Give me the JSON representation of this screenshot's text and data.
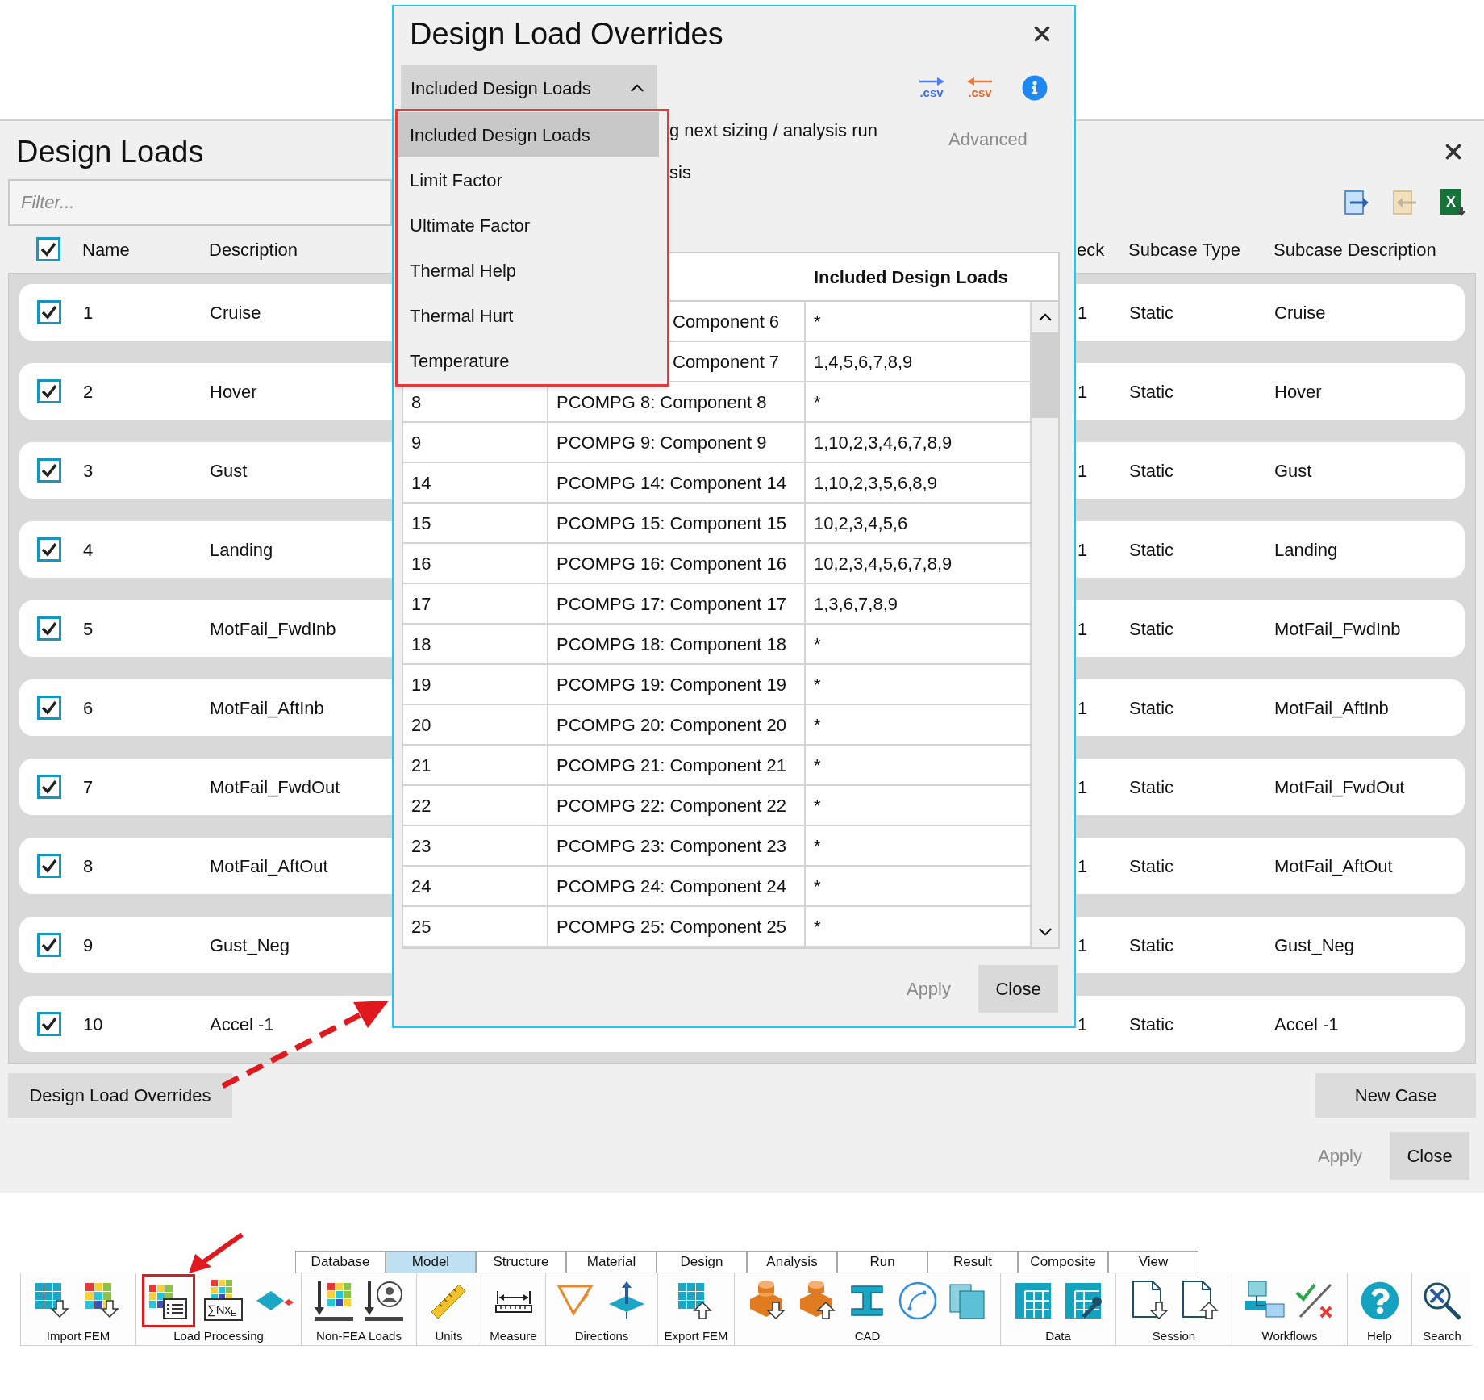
{
  "main_window": {
    "title": "Design Loads",
    "filter": {
      "placeholder": "Filter..."
    },
    "excel_icon_letter": "X",
    "select_all": {
      "checked": true
    },
    "columns": [
      "Name",
      "Description",
      "eck",
      "Subcase Type",
      "Subcase Description"
    ],
    "rows": [
      {
        "checked": true,
        "name": "1",
        "description": "Cruise",
        "column_3": "1",
        "subcase_type": "Static",
        "subcase_description": "Cruise"
      },
      {
        "checked": true,
        "name": "2",
        "description": "Hover",
        "column_3": "1",
        "subcase_type": "Static",
        "subcase_description": "Hover"
      },
      {
        "checked": true,
        "name": "3",
        "description": "Gust",
        "column_3": "1",
        "subcase_type": "Static",
        "subcase_description": "Gust"
      },
      {
        "checked": true,
        "name": "4",
        "description": "Landing",
        "column_3": "1",
        "subcase_type": "Static",
        "subcase_description": "Landing"
      },
      {
        "checked": true,
        "name": "5",
        "description": "MotFail_FwdInb",
        "column_3": "1",
        "subcase_type": "Static",
        "subcase_description": "MotFail_FwdInb"
      },
      {
        "checked": true,
        "name": "6",
        "description": "MotFail_AftInb",
        "column_3": "1",
        "subcase_type": "Static",
        "subcase_description": "MotFail_AftInb"
      },
      {
        "checked": true,
        "name": "7",
        "description": "MotFail_FwdOut",
        "column_3": "1",
        "subcase_type": "Static",
        "subcase_description": "MotFail_FwdOut"
      },
      {
        "checked": true,
        "name": "8",
        "description": "MotFail_AftOut",
        "column_3": "1",
        "subcase_type": "Static",
        "subcase_description": "MotFail_AftOut"
      },
      {
        "checked": true,
        "name": "9",
        "description": "Gust_Neg",
        "column_3": "1",
        "subcase_type": "Static",
        "subcase_description": "Gust_Neg"
      },
      {
        "checked": true,
        "name": "10",
        "description": "Accel -1",
        "column_3": "1",
        "subcase_type": "Static",
        "subcase_description": "Accel -1"
      }
    ],
    "overrides_button": "Design Load Overrides",
    "new_case_button": "New Case",
    "footer_buttons": [
      {
        "label": "Apply",
        "disabled": true
      },
      {
        "label": "Close",
        "disabled": false
      }
    ]
  },
  "dialog": {
    "title": "Design Load Overrides",
    "dropdown": {
      "value": "Included Design Loads",
      "expanded": true,
      "options": [
        {
          "label": "Included Design Loads",
          "selected": true
        },
        {
          "label": "Limit Factor",
          "selected": false
        },
        {
          "label": "Ultimate Factor",
          "selected": false
        },
        {
          "label": "Thermal Help",
          "selected": false
        },
        {
          "label": "Thermal Hurt",
          "selected": false
        },
        {
          "label": "Temperature",
          "selected": false
        }
      ]
    },
    "export_csv_label": ".csv",
    "import_csv_label": ".csv",
    "partial_texts": [
      "g next sizing / analysis run",
      "sis"
    ],
    "advanced": {
      "label": "Advanced",
      "disabled": true
    },
    "table": {
      "column_3_header": "Included Design Loads",
      "rows": [
        {
          "cell_2": "Component 6",
          "cell_3": "*"
        },
        {
          "cell_2": "Component 7",
          "cell_3": "1,4,5,6,7,8,9"
        },
        {
          "cell_1": "8",
          "cell_2": "PCOMPG 8: Component 8",
          "cell_3": "*"
        },
        {
          "cell_1": "9",
          "cell_2": "PCOMPG 9: Component 9",
          "cell_3": "1,10,2,3,4,6,7,8,9"
        },
        {
          "cell_1": "14",
          "cell_2": "PCOMPG 14: Component 14",
          "cell_3": "1,10,2,3,5,6,8,9"
        },
        {
          "cell_1": "15",
          "cell_2": "PCOMPG 15: Component 15",
          "cell_3": "10,2,3,4,5,6"
        },
        {
          "cell_1": "16",
          "cell_2": "PCOMPG 16: Component 16",
          "cell_3": "10,2,3,4,5,6,7,8,9"
        },
        {
          "cell_1": "17",
          "cell_2": "PCOMPG 17: Component 17",
          "cell_3": "1,3,6,7,8,9"
        },
        {
          "cell_1": "18",
          "cell_2": "PCOMPG 18: Component 18",
          "cell_3": "*"
        },
        {
          "cell_1": "19",
          "cell_2": "PCOMPG 19: Component 19",
          "cell_3": "*"
        },
        {
          "cell_1": "20",
          "cell_2": "PCOMPG 20: Component 20",
          "cell_3": "*"
        },
        {
          "cell_1": "21",
          "cell_2": "PCOMPG 21: Component 21",
          "cell_3": "*"
        },
        {
          "cell_1": "22",
          "cell_2": "PCOMPG 22: Component 22",
          "cell_3": "*"
        },
        {
          "cell_1": "23",
          "cell_2": "PCOMPG 23: Component 23",
          "cell_3": "*"
        },
        {
          "cell_1": "24",
          "cell_2": "PCOMPG 24: Component 24",
          "cell_3": "*"
        },
        {
          "cell_1": "25",
          "cell_2": "PCOMPG 25: Component 25",
          "cell_3": "*"
        }
      ]
    },
    "buttons": [
      {
        "label": "Apply",
        "disabled": true
      },
      {
        "label": "Close",
        "disabled": false
      }
    ]
  },
  "ribbon": {
    "tabs": [
      {
        "label": "Database",
        "selected": false
      },
      {
        "label": "Model",
        "selected": true
      },
      {
        "label": "Structure",
        "selected": false
      },
      {
        "label": "Material",
        "selected": false
      },
      {
        "label": "Design",
        "selected": false
      },
      {
        "label": "Analysis",
        "selected": false
      },
      {
        "label": "Run",
        "selected": false
      },
      {
        "label": "Result",
        "selected": false
      },
      {
        "label": "Composite",
        "selected": false
      },
      {
        "label": "View",
        "selected": false
      }
    ],
    "load_sum_icon_text": "∑Nx$_{E}$",
    "groups": [
      "Import FEM",
      "Load Processing",
      "Non-FEA Loads",
      "Units",
      "Measure",
      "Directions",
      "Export FEM",
      "CAD",
      "Data",
      "Session",
      "Workflows",
      "Help",
      "Search"
    ]
  }
}
